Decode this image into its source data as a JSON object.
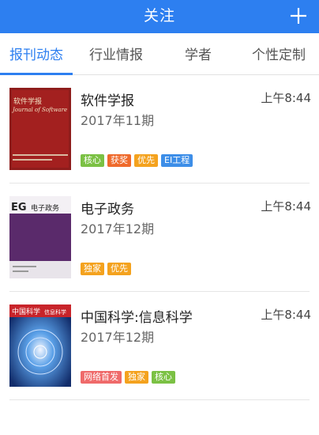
{
  "header": {
    "title": "关注"
  },
  "tabs": [
    {
      "label": "报刊动态"
    },
    {
      "label": "行业情报"
    },
    {
      "label": "学者"
    },
    {
      "label": "个性定制"
    }
  ],
  "items": [
    {
      "name": "软件学报",
      "issue": "2017年11期",
      "time": "上午8:44",
      "cover_text": [
        "软件学报",
        "Journal of Software"
      ],
      "tags": [
        {
          "label": "核心",
          "color": "#7bc144"
        },
        {
          "label": "获奖",
          "color": "#ef6a2c"
        },
        {
          "label": "优先",
          "color": "#f4a21e"
        },
        {
          "label": "EI工程",
          "color": "#3d8ee8"
        }
      ]
    },
    {
      "name": "电子政务",
      "issue": "2017年12期",
      "time": "上午8:44",
      "cover_text": [
        "EG",
        "电子政务"
      ],
      "tags": [
        {
          "label": "独家",
          "color": "#f4a21e"
        },
        {
          "label": "优先",
          "color": "#f4a21e"
        }
      ]
    },
    {
      "name": "中国科学:信息科学",
      "issue": "2017年12期",
      "time": "上午8:44",
      "cover_text": [
        "中国科学",
        "信息科学"
      ],
      "tags": [
        {
          "label": "网络首发",
          "color": "#ef6a6a"
        },
        {
          "label": "独家",
          "color": "#f4a21e"
        },
        {
          "label": "核心",
          "color": "#7bc144"
        }
      ]
    }
  ]
}
